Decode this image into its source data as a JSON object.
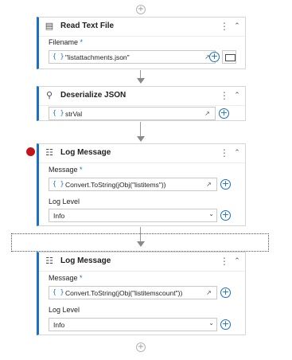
{
  "top_add": "+",
  "bottom_add": "+",
  "activities": [
    {
      "title": "Read Text File",
      "icon": "read-text-file-icon",
      "fields": [
        {
          "label": "Filename",
          "required": "*",
          "value": "\"listattachments.json\"",
          "curly": "{ }"
        }
      ]
    },
    {
      "title": "Deserialize JSON",
      "icon": "deserialize-json-icon",
      "fields": [
        {
          "value": "strVal",
          "curly": "{ }"
        }
      ]
    },
    {
      "title": "Log Message",
      "icon": "log-message-icon",
      "fields": [
        {
          "label": "Message",
          "required": "*",
          "value": "Convert.ToString(jObj(\"listitems\"))",
          "curly": "{ }"
        },
        {
          "label": "Log Level",
          "value": "Info"
        }
      ]
    },
    {
      "title": "Log Message",
      "icon": "log-message-icon",
      "fields": [
        {
          "label": "Message",
          "required": "*",
          "value": "Convert.ToString(jObj(\"listitemscount\"))",
          "curly": "{ }"
        },
        {
          "label": "Log Level",
          "value": "Info"
        }
      ]
    }
  ],
  "colors": {
    "accent": "#1a6fc9",
    "breakpoint": "#c3141c"
  }
}
